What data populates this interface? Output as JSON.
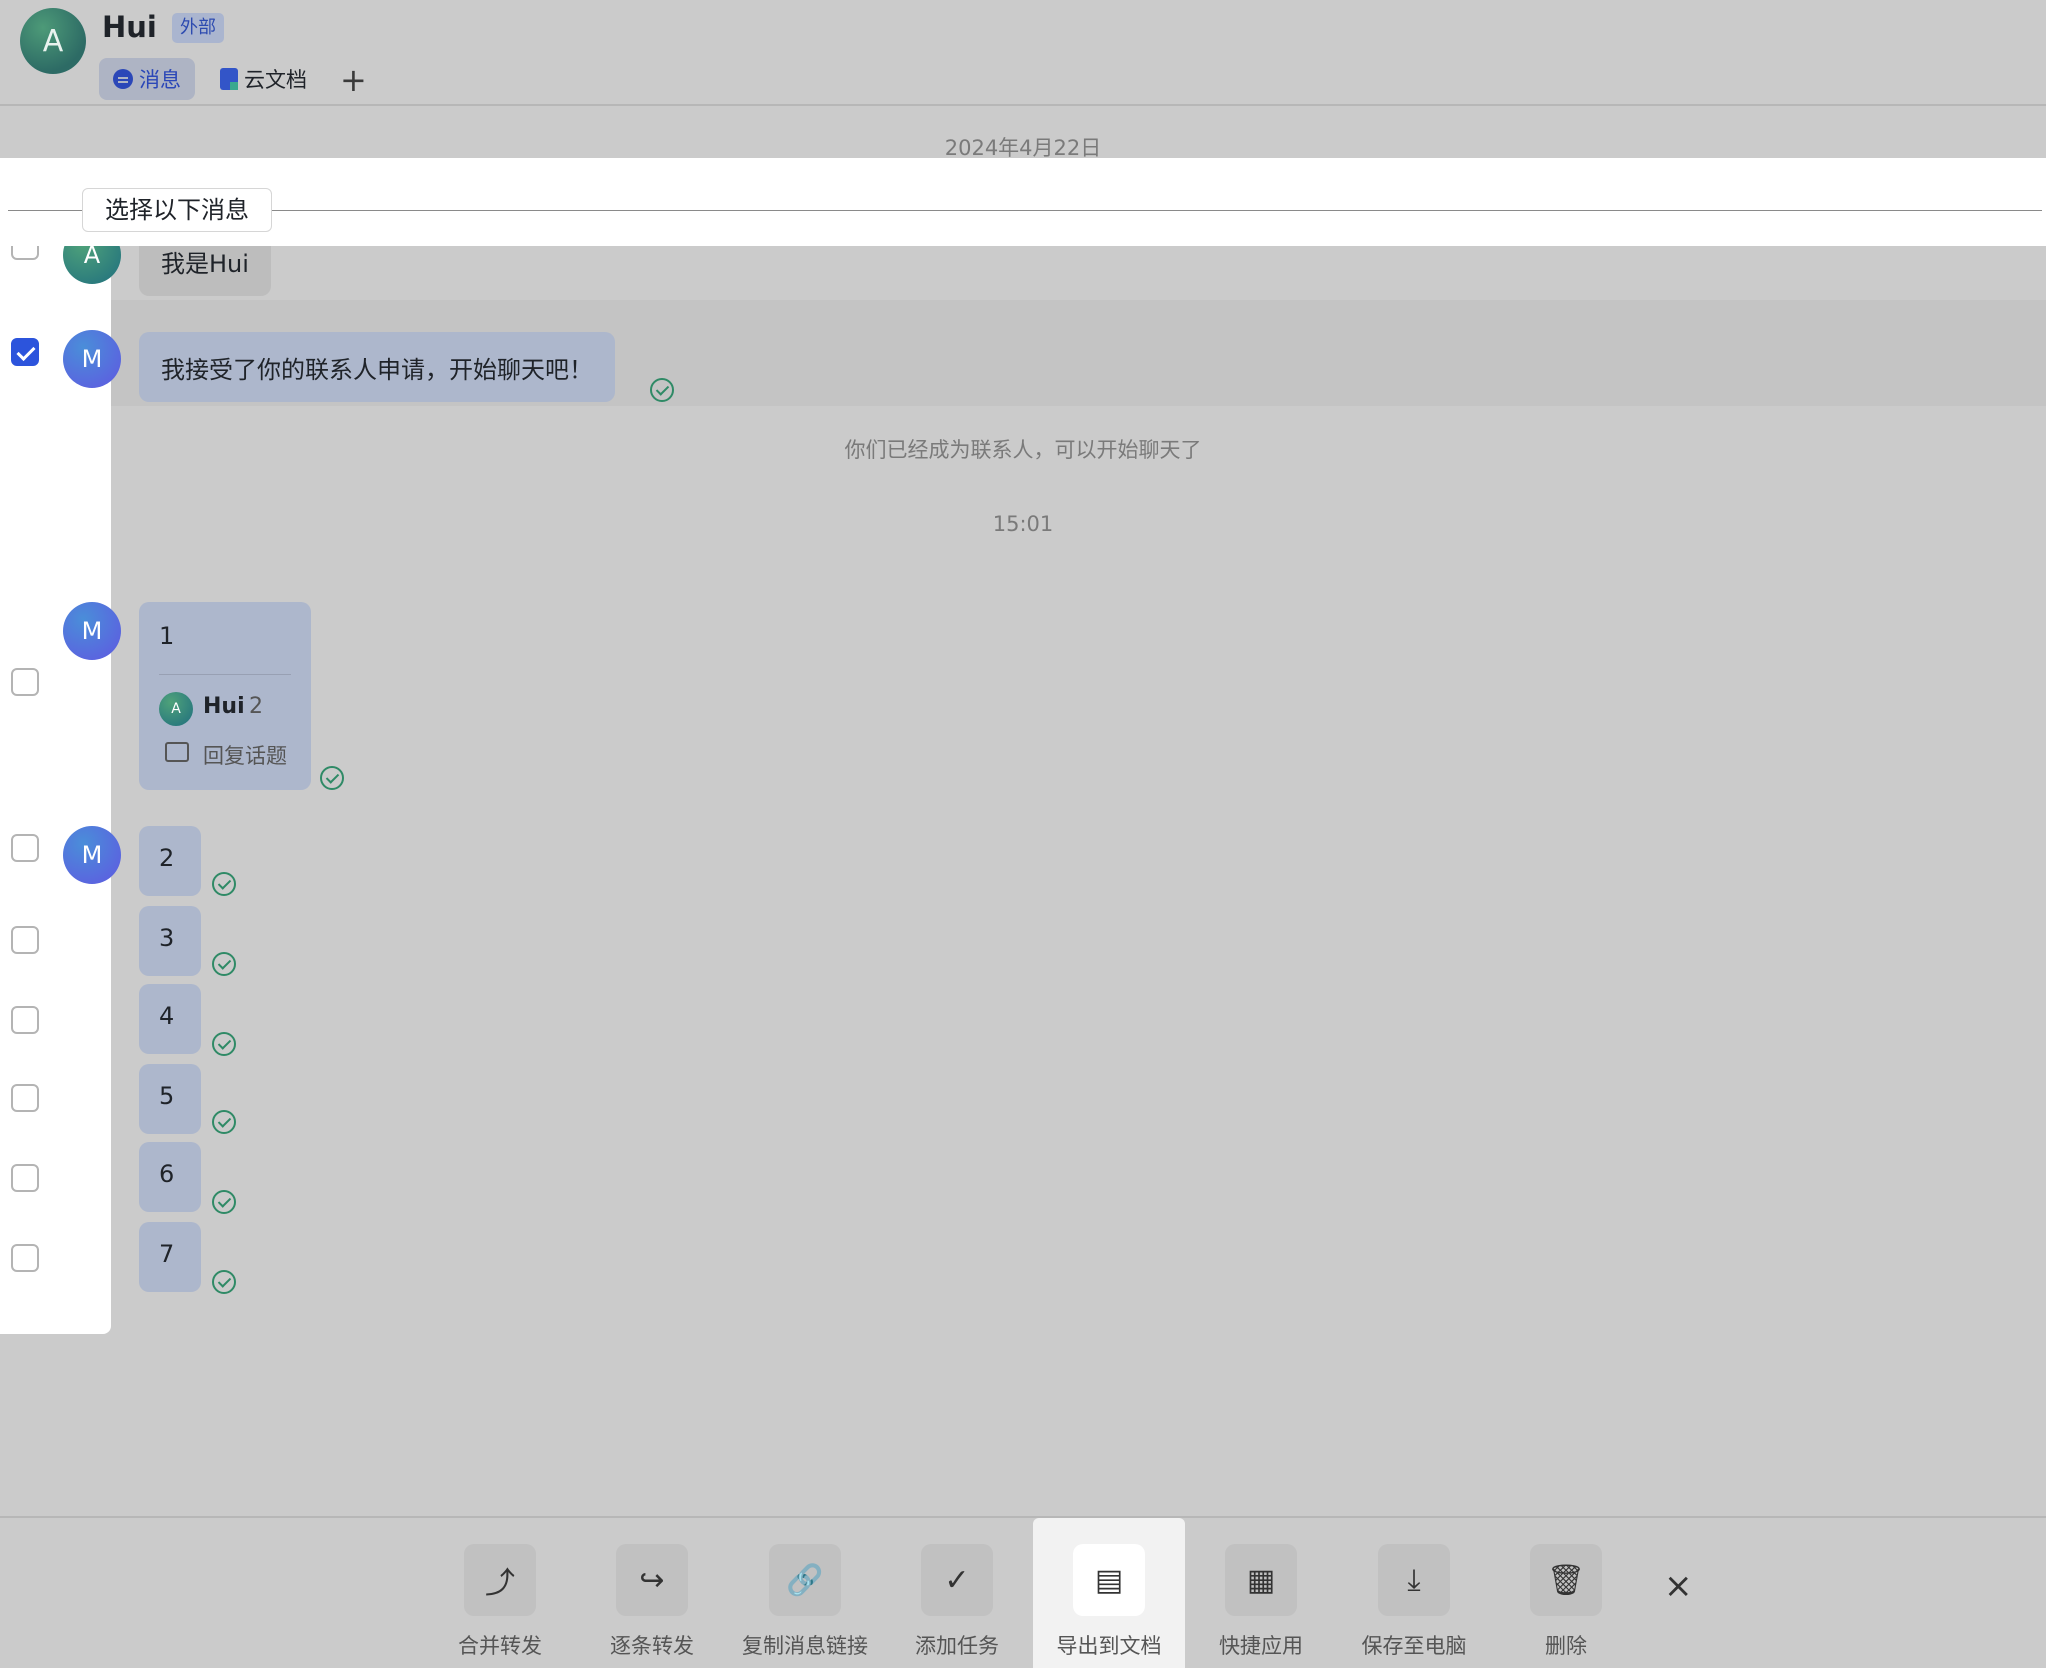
{
  "header": {
    "avatar_letter": "A",
    "name": "Hui",
    "badge": "外部",
    "tabs": [
      {
        "label": "消息",
        "icon": "message-icon",
        "active": true
      },
      {
        "label": "云文档",
        "icon": "doc-icon",
        "active": false
      }
    ],
    "add_tab": "+"
  },
  "chat": {
    "date_separator": "2024年4月22日",
    "select_below_label": "选择以下消息",
    "messages": [
      {
        "sender": "A",
        "text": "我是Hui",
        "checked": false
      },
      {
        "sender": "M",
        "text": "我接受了你的联系人申请，开始聊天吧！",
        "checked": true
      }
    ],
    "system_note": "你们已经成为联系人，可以开始聊天了",
    "time_separator": "15:01",
    "thread_message": {
      "sender": "M",
      "text": "1",
      "reply_avatar": "A",
      "reply_name": "Hui",
      "reply_count": "2",
      "reply_action": "回复话题"
    },
    "numbers": [
      {
        "sender": "M",
        "text": "2"
      },
      {
        "text": "3"
      },
      {
        "text": "4"
      },
      {
        "text": "5"
      },
      {
        "text": "6"
      },
      {
        "text": "7"
      }
    ]
  },
  "toolbar": {
    "items": [
      {
        "label": "合并转发",
        "icon": "merge-forward-icon"
      },
      {
        "label": "逐条转发",
        "icon": "forward-icon"
      },
      {
        "label": "复制消息链接",
        "icon": "copy-link-icon"
      },
      {
        "label": "添加任务",
        "icon": "task-icon"
      },
      {
        "label": "导出到文档",
        "icon": "export-doc-icon",
        "active": true
      },
      {
        "label": "快捷应用",
        "icon": "apps-grid-icon"
      },
      {
        "label": "保存至电脑",
        "icon": "download-icon"
      },
      {
        "label": "删除",
        "icon": "trash-icon"
      }
    ],
    "close": "×"
  },
  "colors": {
    "accent": "#2c54dc",
    "bubble": "#adb7cc",
    "read": "#2f8a66"
  }
}
